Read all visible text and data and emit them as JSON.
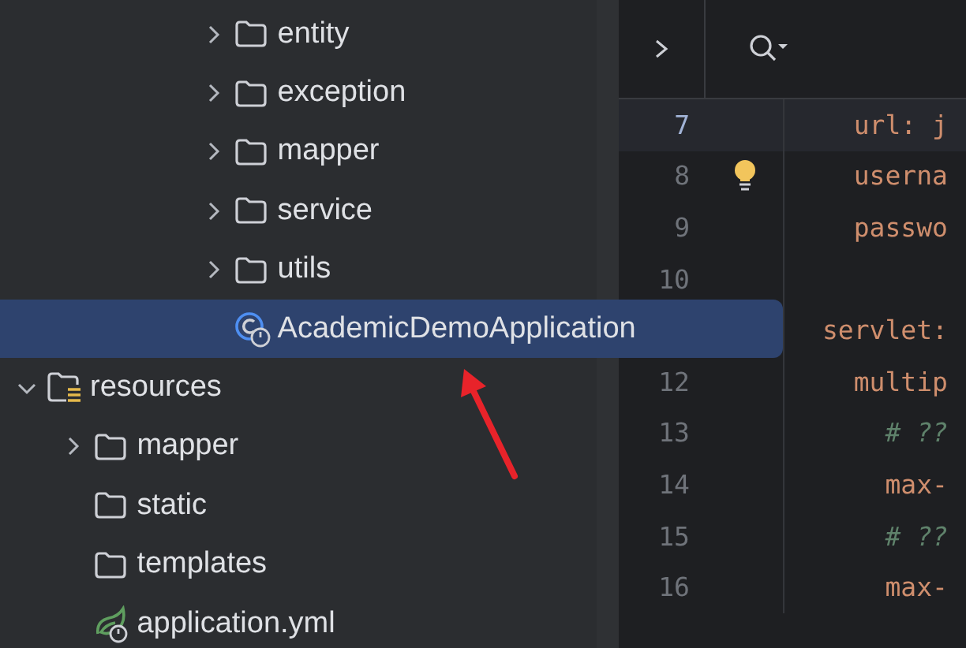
{
  "project_tree": [
    {
      "children": [
        {
          "children": [
            {
              "children": [
                {
                  "children": [
                    {
                      "children": [
                        {
                          "label": "entity",
                          "kind": "folder",
                          "expanded": false,
                          "selected": false
                        },
                        {
                          "label": "exception",
                          "kind": "folder",
                          "expanded": false,
                          "selected": false
                        },
                        {
                          "label": "mapper",
                          "kind": "folder",
                          "expanded": false,
                          "selected": false
                        },
                        {
                          "label": "service",
                          "kind": "folder",
                          "expanded": false,
                          "selected": false
                        },
                        {
                          "label": "utils",
                          "kind": "folder",
                          "expanded": false,
                          "selected": false
                        },
                        {
                          "label": "AcademicDemoApplication",
                          "kind": "app-class",
                          "selected": true
                        }
                      ]
                    }
                  ]
                }
              ]
            }
          ]
        },
        {
          "label": "resources",
          "kind": "resources-folder",
          "expanded": true,
          "selected": false,
          "children": [
            {
              "label": "mapper",
              "kind": "folder",
              "expanded": false,
              "selected": false
            },
            {
              "label": "static",
              "kind": "folder",
              "selected": false
            },
            {
              "label": "templates",
              "kind": "folder",
              "selected": false
            },
            {
              "label": "application.yml",
              "kind": "spring-yaml",
              "selected": false
            }
          ]
        }
      ]
    }
  ],
  "editor": {
    "lines": [
      {
        "number": "7",
        "text": "  url: j",
        "kind": "key",
        "current": true,
        "bulb": false
      },
      {
        "number": "8",
        "text": "  userna",
        "kind": "key",
        "current": false,
        "bulb": true
      },
      {
        "number": "9",
        "text": "  passwo",
        "kind": "key",
        "current": false,
        "bulb": false
      },
      {
        "number": "10",
        "current": false,
        "bulb": false
      },
      {
        "text": "servlet:",
        "kind": "key",
        "current": false,
        "bulb": false
      },
      {
        "number": "12",
        "text": "  multip",
        "kind": "key",
        "current": false,
        "bulb": false
      },
      {
        "number": "13",
        "text": "    # ??",
        "kind": "comment",
        "current": false,
        "bulb": false
      },
      {
        "number": "14",
        "text": "    max-",
        "kind": "key",
        "current": false,
        "bulb": false
      },
      {
        "number": "15",
        "text": "    # ??",
        "kind": "comment",
        "current": false,
        "bulb": false
      },
      {
        "number": "16",
        "text": "    max-",
        "kind": "key",
        "current": false,
        "bulb": false
      }
    ]
  }
}
